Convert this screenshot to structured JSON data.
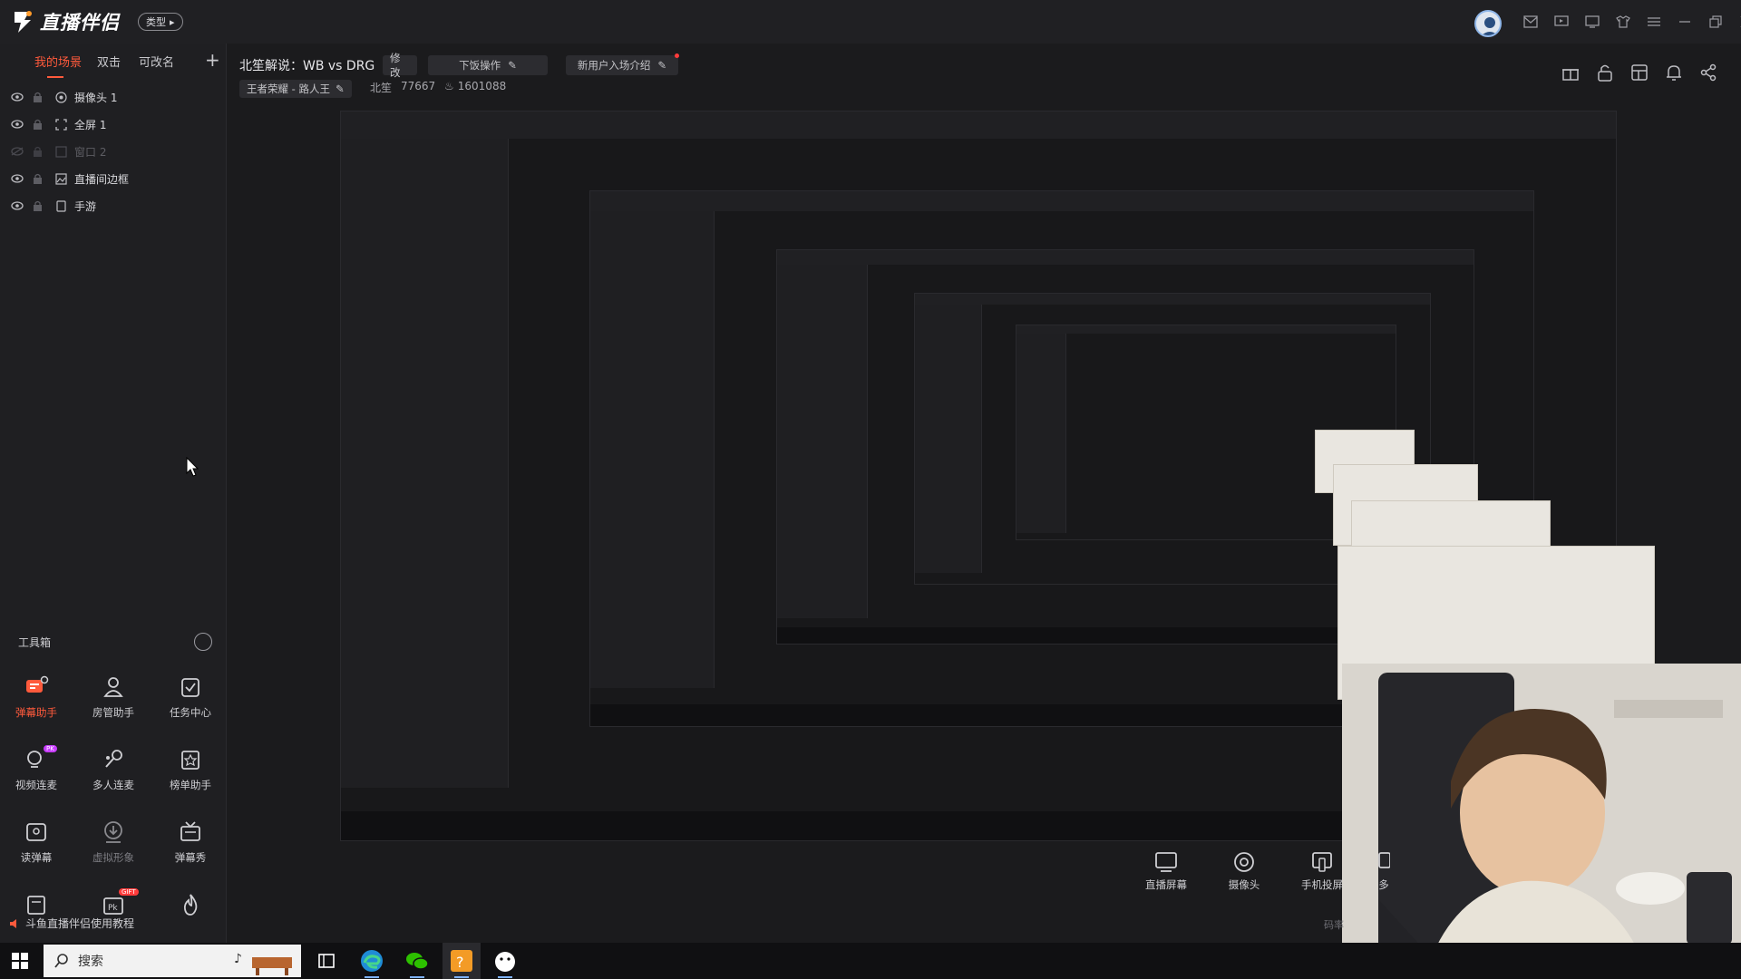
{
  "app": {
    "name": "直播伴侣",
    "type_label": "类型"
  },
  "sidebar": {
    "tabs": [
      "我的场景",
      "双击",
      "可改名"
    ],
    "add_label": "+",
    "scenes": [
      {
        "label": "摄像头 1",
        "visible": true
      },
      {
        "label": "全屏 1",
        "visible": true
      },
      {
        "label": "窗口 2",
        "visible": false
      },
      {
        "label": "直播间边框",
        "visible": true
      },
      {
        "label": "手游",
        "visible": true
      }
    ],
    "toolbox_title": "工具箱",
    "tools": [
      {
        "label": "弹幕助手",
        "icon": "danmaku-icon",
        "active": true
      },
      {
        "label": "房管助手",
        "icon": "room-admin-icon"
      },
      {
        "label": "任务中心",
        "icon": "task-center-icon"
      },
      {
        "label": "视频连麦",
        "icon": "video-mic-icon",
        "badge": "PK"
      },
      {
        "label": "多人连麦",
        "icon": "multi-mic-icon"
      },
      {
        "label": "榜单助手",
        "icon": "ranking-icon"
      },
      {
        "label": "读弹幕",
        "icon": "read-danmaku-icon"
      },
      {
        "label": "虚拟形象",
        "icon": "avatar-download-icon",
        "dim": true
      },
      {
        "label": "弹幕秀",
        "icon": "danmaku-show-icon"
      },
      {
        "label": "",
        "icon": "calendar-icon"
      },
      {
        "label": "",
        "icon": "pk-gift-icon",
        "badge": "GIFT"
      },
      {
        "label": "",
        "icon": "fire-icon"
      }
    ],
    "tutorial": "斗鱼直播伴侣使用教程"
  },
  "header": {
    "room_title": "北笙解说：WB vs DRG",
    "edit_label": "修改",
    "stream_op": "下饭操作",
    "new_user_intro": "新用户入场介绍",
    "category": "王者荣耀 - 路人王",
    "streamer": "北笙",
    "room_id": "77667",
    "heat": "1601088"
  },
  "bottom_tools": [
    {
      "label": "直播屏幕",
      "icon": "screen-icon"
    },
    {
      "label": "摄像头",
      "icon": "camera-icon"
    },
    {
      "label": "手机投屏",
      "icon": "phone-cast-icon"
    },
    {
      "label": "多",
      "icon": "more-source-icon"
    }
  ],
  "preview_footer": "码率",
  "taskbar": {
    "search_placeholder": "搜索",
    "apps": [
      "task-view-icon",
      "edge-icon",
      "wechat-icon",
      "douyu-companion-icon",
      "penguin-app-icon"
    ]
  },
  "colors": {
    "accent": "#ff5a3c",
    "bg": "#1b1b1d",
    "sidebar": "#1f1f22"
  }
}
